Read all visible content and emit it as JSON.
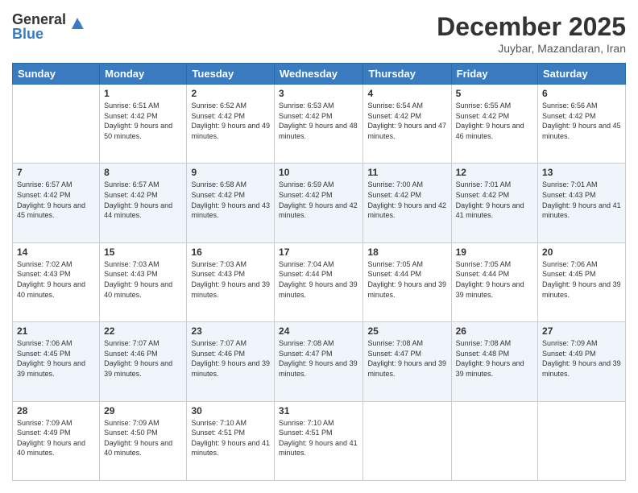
{
  "logo": {
    "general": "General",
    "blue": "Blue"
  },
  "header": {
    "month": "December 2025",
    "location": "Juybar, Mazandaran, Iran"
  },
  "weekdays": [
    "Sunday",
    "Monday",
    "Tuesday",
    "Wednesday",
    "Thursday",
    "Friday",
    "Saturday"
  ],
  "weeks": [
    [
      {
        "day": "",
        "sunrise": "",
        "sunset": "",
        "daylight": ""
      },
      {
        "day": "1",
        "sunrise": "6:51 AM",
        "sunset": "4:42 PM",
        "daylight": "9 hours and 50 minutes."
      },
      {
        "day": "2",
        "sunrise": "6:52 AM",
        "sunset": "4:42 PM",
        "daylight": "9 hours and 49 minutes."
      },
      {
        "day": "3",
        "sunrise": "6:53 AM",
        "sunset": "4:42 PM",
        "daylight": "9 hours and 48 minutes."
      },
      {
        "day": "4",
        "sunrise": "6:54 AM",
        "sunset": "4:42 PM",
        "daylight": "9 hours and 47 minutes."
      },
      {
        "day": "5",
        "sunrise": "6:55 AM",
        "sunset": "4:42 PM",
        "daylight": "9 hours and 46 minutes."
      },
      {
        "day": "6",
        "sunrise": "6:56 AM",
        "sunset": "4:42 PM",
        "daylight": "9 hours and 45 minutes."
      }
    ],
    [
      {
        "day": "7",
        "sunrise": "6:57 AM",
        "sunset": "4:42 PM",
        "daylight": "9 hours and 45 minutes."
      },
      {
        "day": "8",
        "sunrise": "6:57 AM",
        "sunset": "4:42 PM",
        "daylight": "9 hours and 44 minutes."
      },
      {
        "day": "9",
        "sunrise": "6:58 AM",
        "sunset": "4:42 PM",
        "daylight": "9 hours and 43 minutes."
      },
      {
        "day": "10",
        "sunrise": "6:59 AM",
        "sunset": "4:42 PM",
        "daylight": "9 hours and 42 minutes."
      },
      {
        "day": "11",
        "sunrise": "7:00 AM",
        "sunset": "4:42 PM",
        "daylight": "9 hours and 42 minutes."
      },
      {
        "day": "12",
        "sunrise": "7:01 AM",
        "sunset": "4:42 PM",
        "daylight": "9 hours and 41 minutes."
      },
      {
        "day": "13",
        "sunrise": "7:01 AM",
        "sunset": "4:43 PM",
        "daylight": "9 hours and 41 minutes."
      }
    ],
    [
      {
        "day": "14",
        "sunrise": "7:02 AM",
        "sunset": "4:43 PM",
        "daylight": "9 hours and 40 minutes."
      },
      {
        "day": "15",
        "sunrise": "7:03 AM",
        "sunset": "4:43 PM",
        "daylight": "9 hours and 40 minutes."
      },
      {
        "day": "16",
        "sunrise": "7:03 AM",
        "sunset": "4:43 PM",
        "daylight": "9 hours and 39 minutes."
      },
      {
        "day": "17",
        "sunrise": "7:04 AM",
        "sunset": "4:44 PM",
        "daylight": "9 hours and 39 minutes."
      },
      {
        "day": "18",
        "sunrise": "7:05 AM",
        "sunset": "4:44 PM",
        "daylight": "9 hours and 39 minutes."
      },
      {
        "day": "19",
        "sunrise": "7:05 AM",
        "sunset": "4:44 PM",
        "daylight": "9 hours and 39 minutes."
      },
      {
        "day": "20",
        "sunrise": "7:06 AM",
        "sunset": "4:45 PM",
        "daylight": "9 hours and 39 minutes."
      }
    ],
    [
      {
        "day": "21",
        "sunrise": "7:06 AM",
        "sunset": "4:45 PM",
        "daylight": "9 hours and 39 minutes."
      },
      {
        "day": "22",
        "sunrise": "7:07 AM",
        "sunset": "4:46 PM",
        "daylight": "9 hours and 39 minutes."
      },
      {
        "day": "23",
        "sunrise": "7:07 AM",
        "sunset": "4:46 PM",
        "daylight": "9 hours and 39 minutes."
      },
      {
        "day": "24",
        "sunrise": "7:08 AM",
        "sunset": "4:47 PM",
        "daylight": "9 hours and 39 minutes."
      },
      {
        "day": "25",
        "sunrise": "7:08 AM",
        "sunset": "4:47 PM",
        "daylight": "9 hours and 39 minutes."
      },
      {
        "day": "26",
        "sunrise": "7:08 AM",
        "sunset": "4:48 PM",
        "daylight": "9 hours and 39 minutes."
      },
      {
        "day": "27",
        "sunrise": "7:09 AM",
        "sunset": "4:49 PM",
        "daylight": "9 hours and 39 minutes."
      }
    ],
    [
      {
        "day": "28",
        "sunrise": "7:09 AM",
        "sunset": "4:49 PM",
        "daylight": "9 hours and 40 minutes."
      },
      {
        "day": "29",
        "sunrise": "7:09 AM",
        "sunset": "4:50 PM",
        "daylight": "9 hours and 40 minutes."
      },
      {
        "day": "30",
        "sunrise": "7:10 AM",
        "sunset": "4:51 PM",
        "daylight": "9 hours and 41 minutes."
      },
      {
        "day": "31",
        "sunrise": "7:10 AM",
        "sunset": "4:51 PM",
        "daylight": "9 hours and 41 minutes."
      },
      {
        "day": "",
        "sunrise": "",
        "sunset": "",
        "daylight": ""
      },
      {
        "day": "",
        "sunrise": "",
        "sunset": "",
        "daylight": ""
      },
      {
        "day": "",
        "sunrise": "",
        "sunset": "",
        "daylight": ""
      }
    ]
  ],
  "labels": {
    "sunrise": "Sunrise:",
    "sunset": "Sunset:",
    "daylight": "Daylight:"
  }
}
